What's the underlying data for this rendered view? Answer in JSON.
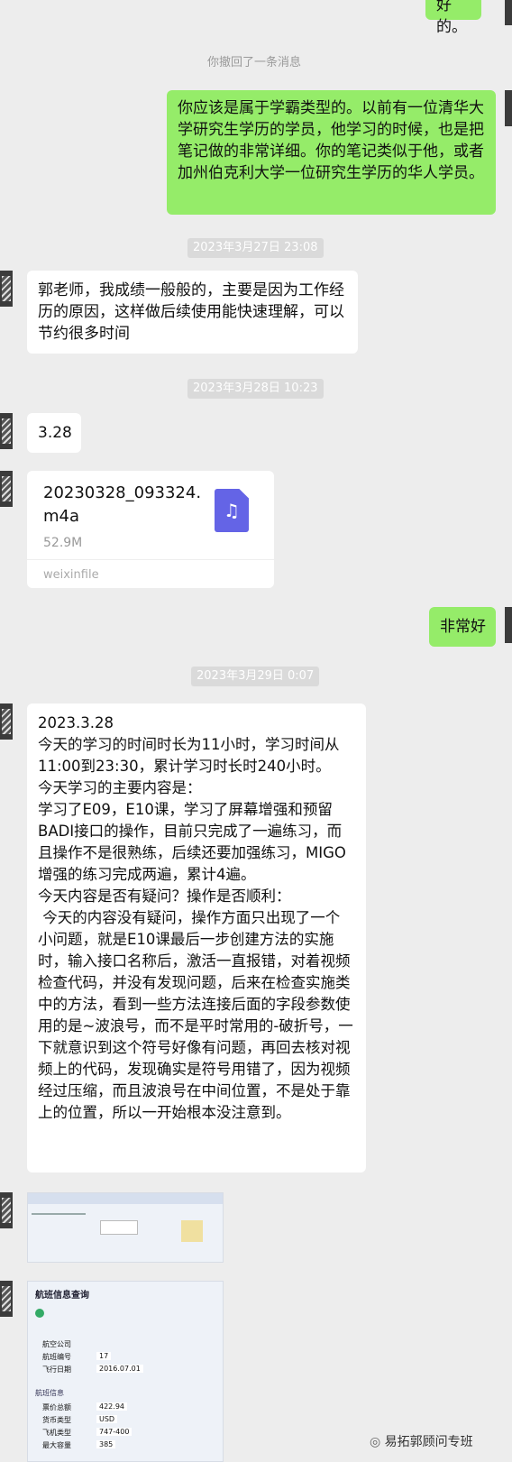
{
  "messages": {
    "partial_top": "好的。",
    "recall_notice": "你撤回了一条消息",
    "msg_teacher_long": "你应该是属于学霸类型的。以前有一位清华大学研究生学历的学员，他学习的时候，也是把笔记做的非常详细。你的笔记类似于他，或者加州伯克利大学一位研究生学历的华人学员。",
    "time1": "2023年3月27日 23:08",
    "msg_student_1": "郭老师，我成绩一般般的，主要是因为工作经历的原因，这样做后续使用能快速理解，可以节约很多时间",
    "time2": "2023年3月28日 10:23",
    "msg_student_2": "3.28",
    "file": {
      "name": "20230328_093324.m4a",
      "size": "52.9M",
      "source": "weixinfile",
      "icon": "music-file-icon"
    },
    "msg_teacher_short": "非常好",
    "time3": "2023年3月29日 0:07",
    "msg_student_notes": "2023.3.28\n今天的学习的时间时长为11小时，学习时间从11:00到23:30，累计学习时长时240小时。\n今天学习的主要内容是：\n学习了E09，E10课，学习了屏幕增强和预留BADI接口的操作，目前只完成了一遍练习，而且操作不是很熟练，后续还要加强练习，MIGO增强的练习完成两遍，累计4遍。\n今天内容是否有疑问？操作是否顺利：\n 今天的内容没有疑问，操作方面只出现了一个小问题，就是E10课最后一步创建方法的实施时，输入接口名称后，激活一直报错，对着视频检查代码，并没有发现问题，后来在检查实施类中的方法，看到一些方法连接后面的字段参数使用的是~波浪号，而不是平时常用的-破折号，一下就意识到这个符号好像有问题，再回去核对视频上的代码，发现确实是符号用错了，因为视频经过压缩，而且波浪号在中间位置，不是处于靠上的位置，所以一开始根本没注意到。"
  },
  "screenshot2": {
    "title": "航班信息查询",
    "field_labels": [
      "航空公司",
      "航班编号",
      "飞行日期",
      "票价总额",
      "货币类型",
      "飞机类型",
      "最大容量"
    ],
    "values": [
      "17",
      "2016.07.01",
      "422.94",
      "USD",
      "747-400",
      "385"
    ],
    "section": "航班信息"
  },
  "watermark": "易拓郭顾问专班"
}
